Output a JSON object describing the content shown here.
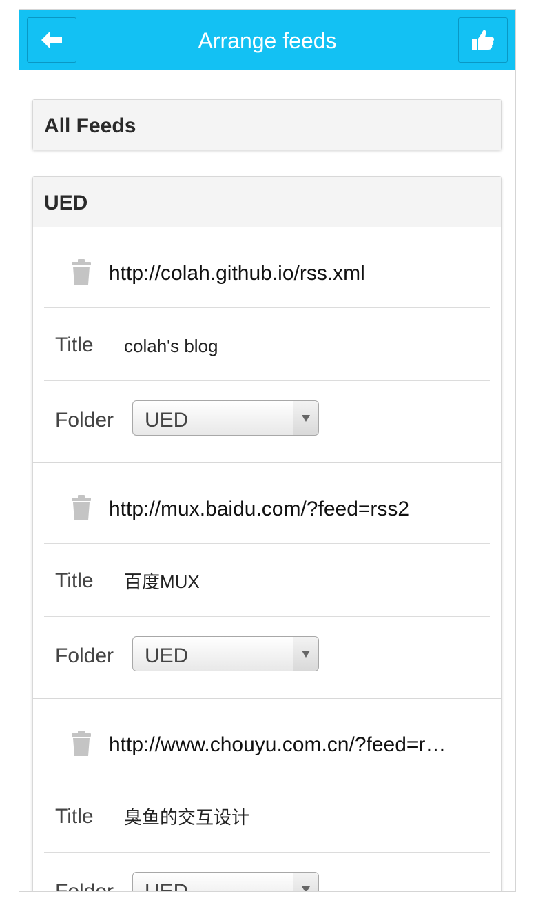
{
  "header": {
    "title": "Arrange feeds",
    "back_icon": "back-arrow-icon",
    "like_icon": "thumbs-up-icon"
  },
  "all_feeds": {
    "label": "All Feeds"
  },
  "group": {
    "name": "UED",
    "field_labels": {
      "title": "Title",
      "folder": "Folder"
    },
    "feeds": [
      {
        "url": "http://colah.github.io/rss.xml",
        "title": "colah's blog",
        "folder": "UED"
      },
      {
        "url": "http://mux.baidu.com/?feed=rss2",
        "title": "百度MUX",
        "folder": "UED"
      },
      {
        "url": "http://www.chouyu.com.cn/?feed=r…",
        "title": "臭鱼的交互设计",
        "folder": "UED"
      }
    ]
  },
  "colors": {
    "header_bg": "#13c1f3",
    "icon_gray": "#c4c4c4"
  }
}
